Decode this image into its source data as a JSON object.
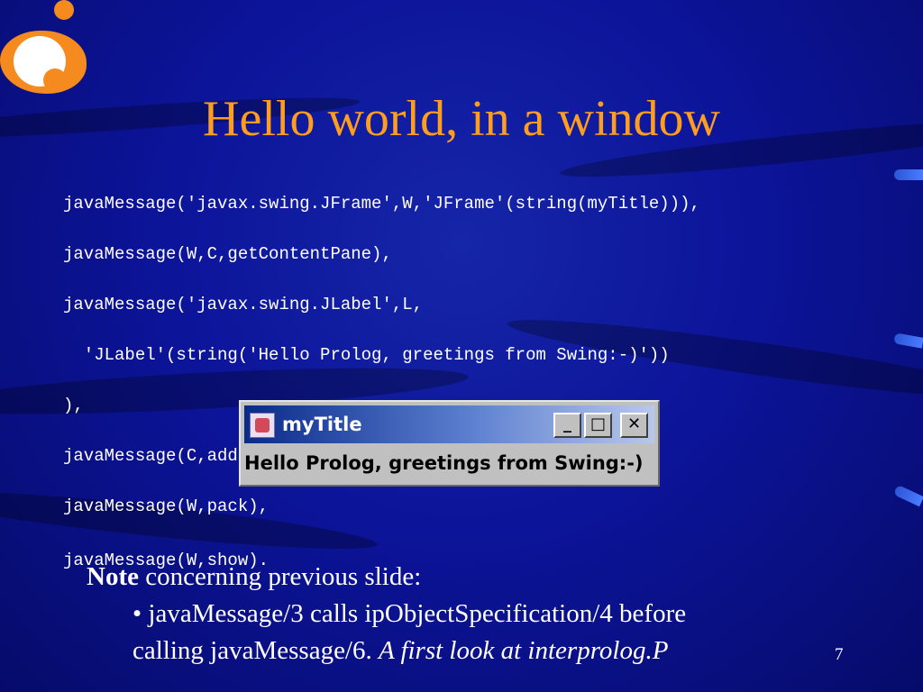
{
  "slide": {
    "title": "Hello world, in a window",
    "page_number": "7"
  },
  "code": {
    "lines": [
      "javaMessage('javax.swing.JFrame',W,'JFrame'(string(myTitle))),",
      "javaMessage(W,C,getContentPane),",
      "javaMessage('javax.swing.JLabel',L,",
      "  'JLabel'(string('Hello Prolog, greetings from Swing:-)'))",
      "),",
      "javaMessage(C,add(string('Center'),L)),",
      "javaMessage(W,pack),",
      "javaMessage(W,show)."
    ]
  },
  "window": {
    "title": "myTitle",
    "label": "Hello Prolog, greetings from Swing:-)",
    "minimize_glyph": "_",
    "maximize_glyph": "□",
    "close_glyph": "✕",
    "icon": "java-app-icon"
  },
  "note": {
    "heading": "Note",
    "heading_rest": " concerning previous slide:",
    "bullet": "• javaMessage/3 calls ipObjectSpecification/4 before",
    "continuation": "calling javaMessage/6. ",
    "italic": "A first look at interprolog.P"
  },
  "colors": {
    "background": "#0c149a",
    "title": "#ff9d1f",
    "logo": "#f58a1f",
    "text": "#ffffff"
  }
}
